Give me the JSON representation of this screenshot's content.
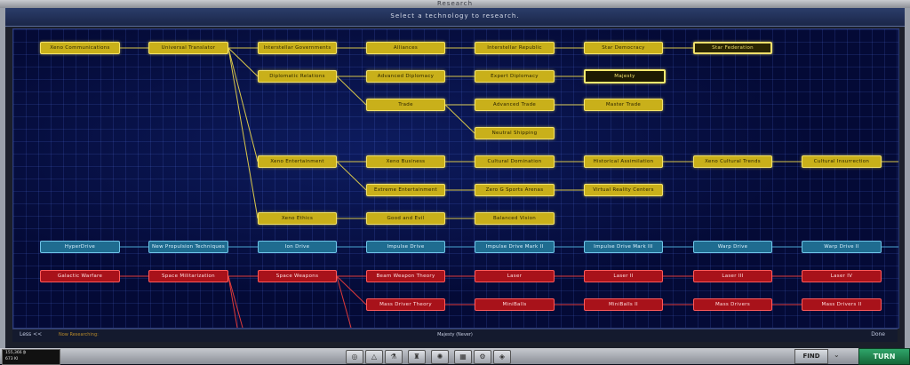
{
  "window_title": "Research",
  "header_title": "Select a technology to research.",
  "nodes": {
    "y_xeno_comm": "Xeno Communications",
    "y_univ_trans": "Universal Translator",
    "y_interstellar_gov": "Interstellar Governments",
    "y_alliances": "Alliances",
    "y_interstellar_rep": "Interstellar Republic",
    "y_star_democracy": "Star Democracy",
    "y_star_federation": "Star Federation",
    "y_diplomatic_rel": "Diplomatic Relations",
    "y_adv_diplomacy": "Advanced Diplomacy",
    "y_expert_diplomacy": "Expert Diplomacy",
    "y_majesty": "Majesty",
    "y_trade": "Trade",
    "y_adv_trade": "Advanced Trade",
    "y_master_trade": "Master Trade",
    "y_neutral_shipping": "Neutral Shipping",
    "y_xeno_ent": "Xeno Entertainment",
    "y_xeno_business": "Xeno Business",
    "y_cultural_dom": "Cultural Domination",
    "y_historical_assim": "Historical Assimilation",
    "y_xeno_cultural": "Xeno Cultural Trends",
    "y_cultural_insur": "Cultural Insurrection",
    "y_extreme_ent": "Extreme Entertainment",
    "y_zero_g": "Zero G Sports Arenas",
    "y_virtual_reality": "Virtual Reality Centers",
    "y_xeno_ethics": "Xeno Ethics",
    "y_good_evil": "Good and Evil",
    "y_balanced_vision": "Balanced Vision",
    "b_hyperdrive": "HyperDrive",
    "b_new_prop": "New Propulsion Techniques",
    "b_ion": "Ion Drive",
    "b_impulse": "Impulse Drive",
    "b_impulse2": "Impulse Drive Mark II",
    "b_impulse3": "Impulse Drive Mark III",
    "b_warp": "Warp Drive",
    "b_warp2": "Warp Drive II",
    "r_galactic": "Galactic Warfare",
    "r_space_mil": "Space Militarization",
    "r_space_weapons": "Space Weapons",
    "r_beam_theory": "Beam Weapon Theory",
    "r_laser": "Laser",
    "r_laser2": "Laser II",
    "r_laser3": "Laser III",
    "r_laser4": "Laser IV",
    "r_mass_theory": "Mass Driver Theory",
    "r_miniballs": "MiniBalls",
    "r_miniballs2": "MiniBalls II",
    "r_mass_drivers": "Mass Drivers",
    "r_mass_drivers2": "Mass Drivers II"
  },
  "footer": {
    "less": "Less <<",
    "now_researching_label": "Now Researching:",
    "current": "Majesty (Never)",
    "done": "Done"
  },
  "bottom": {
    "info_line1": "155,366 ₿",
    "info_line2": "673 KI",
    "find": "FIND",
    "turn": "TURN"
  },
  "colors": {
    "social_tree": "#c9b01a",
    "propulsion_tree": "#1f6c90",
    "weapons_tree": "#a8121a",
    "turn_button": "#2fa66a"
  }
}
